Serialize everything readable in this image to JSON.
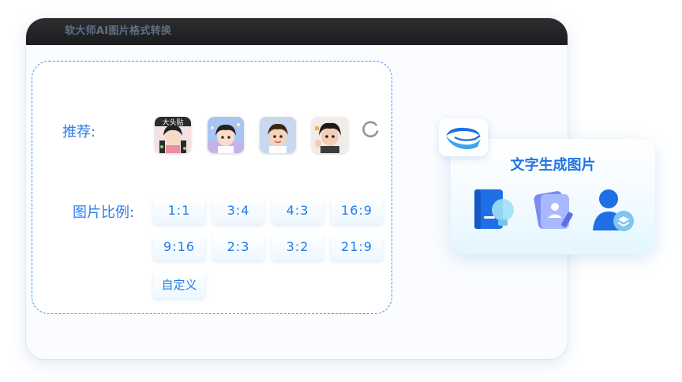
{
  "window": {
    "title": "软大师AI图片格式转换"
  },
  "recommend": {
    "label": "推荐:",
    "thumbs": [
      {
        "name": "thumbnail-1",
        "caption": "大头贴",
        "bg": "#f4e2e2"
      },
      {
        "name": "thumbnail-2",
        "bg": "#a9c6f2"
      },
      {
        "name": "thumbnail-3",
        "bg": "#c9d8ef"
      },
      {
        "name": "thumbnail-4",
        "bg": "#f2ece8"
      }
    ],
    "refresh_icon": "refresh-icon"
  },
  "ratio": {
    "label": "图片比例:",
    "options": [
      "1:1",
      "3:4",
      "4:3",
      "16:9",
      "9:16",
      "2:3",
      "3:2",
      "21:9"
    ],
    "custom_label": "自定义"
  },
  "feature_card": {
    "title": "文字生成图片",
    "icons": [
      "book-lightbulb-icon",
      "id-card-pen-icon",
      "user-layers-icon"
    ],
    "logo_icon": "swirl-logo-icon"
  },
  "colors": {
    "accent": "#2f7de8",
    "titlebar": "#1c1c1e",
    "dashed_border": "#4f8ff0"
  }
}
